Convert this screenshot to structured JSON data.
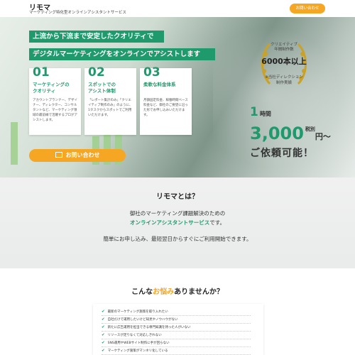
{
  "header": {
    "logo": "リモマ",
    "tagline": "マーケティング特化型オンラインアシスタントサービス",
    "contact_button": "お問い合わせ"
  },
  "hero": {
    "band1": "上流から下流まで安定したクオリティで",
    "band2": "デジタルマーケティングをオンラインでアシストします",
    "cards": [
      {
        "num": "01",
        "title": "マーケティングの\nクオリティ",
        "text": "アカウントプランナー、デザイナー、ディレクター、コンサルタントなど、マーケティング領域の最前線で活躍するプロがアシストします。"
      },
      {
        "num": "02",
        "title": "スポットでの\nアシスト体制",
        "text": "「レポート集計のみ」「クリエイティブ制作のみ」のように、1タスクからスポットでご利用いただけます。"
      },
      {
        "num": "03",
        "title": "柔軟な料金体系",
        "text": "月額固定料金、稼働時間ベース料金など、御社のご要望に沿った形でお申し込みいただけます。"
      }
    ],
    "cta": "お問い合わせ",
    "badge": {
      "l1": "クリエイティブ",
      "l2": "年間制作数",
      "l3": "6000本以上",
      "l4": "※当社ディレクション",
      "l5": "制作実績"
    },
    "price": {
      "unit_num": "1",
      "unit_label": "時間",
      "amount": "3,000",
      "tax": "税別",
      "yen": "円〜",
      "tagline": "ご依頼可能！"
    }
  },
  "about": {
    "title": "リモマとは？",
    "line1": "御社のマーケティング課題解決のための",
    "line2_hl": "オンラインアシスタントサービス",
    "line2_rest": "です。",
    "line3": "簡単にお申し込み、最短翌日からすぐにご利用開始できます。"
  },
  "worries": {
    "title_pre": "こんな",
    "title_hl": "お悩み",
    "title_post": "ありませんか？",
    "items": [
      "最新のマーケティング施策を取り入れたい",
      "自社だけで運用したいけど知見やノウハウがない",
      "新たに広告運用を担当できる専門知識を持った人がいない",
      "リソースが足りなくて対応しきれない",
      "SNS運用やWEBサイト制作に手が回らない",
      "マーケティング施策がマンネリ化している"
    ]
  },
  "colors": {
    "accent_green": "#1f9a6c",
    "accent_orange": "#f5a623"
  }
}
